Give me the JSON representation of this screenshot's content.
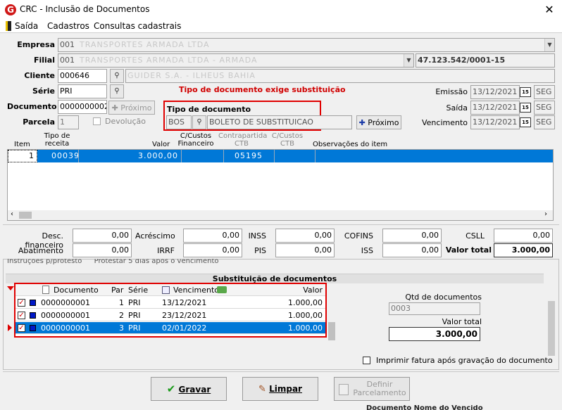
{
  "window": {
    "title": "CRC - Inclusão de Documentos",
    "close": "✕"
  },
  "menu": [
    "Saída",
    "Cadastros",
    "Consultas cadastrais"
  ],
  "labels": {
    "empresa": "Empresa",
    "filial": "Filial",
    "cliente": "Cliente",
    "serie": "Série",
    "documento": "Documento",
    "parcela": "Parcela",
    "devolucao": "Devolução",
    "tipo_doc": "Tipo de documento",
    "emissao": "Emissão",
    "saida": "Saída",
    "vencimento": "Vencimento",
    "proximo": "Próximo",
    "tipo_exige": "Tipo de documento exige substituição"
  },
  "values": {
    "empresa_code": "001",
    "empresa_name": "TRANSPORTES ARMADA LTDA",
    "filial_code": "001",
    "filial_name": "TRANSPORTES ARMADA LTDA - ARMADA",
    "cnpj": "47.123.542/0001-15",
    "cliente_code": "000646",
    "cliente_name": "GUIDER S.A. - ILHEUS BAHIA",
    "serie": "PRI",
    "documento": "0000000002",
    "parcela": "1",
    "tipo_code": "BOS",
    "tipo_name": "BOLETO DE SUBSTITUICAO",
    "emissao": "13/12/2021",
    "saida": "13/12/2021",
    "vencimento": "13/12/2021",
    "weekday": "SEG",
    "cal": "15"
  },
  "grid": {
    "headers": {
      "item": "Item",
      "tipo": "Tipo de\nreceita",
      "valor": "Valor",
      "ccf": "C/Custos\nFinanceiro",
      "cp": "Contrapartida\nCTB",
      "cc": "C/Custos\nCTB",
      "obs": "Observações do item"
    },
    "row": {
      "item": "1",
      "tipo": "00039",
      "valor": "3.000,00",
      "cp": "05195"
    }
  },
  "totals": {
    "desc_fin": "Desc. financeiro",
    "acrescimo": "Acréscimo",
    "inss": "INSS",
    "cofins": "COFINS",
    "csll": "CSLL",
    "abatimento": "Abatimento",
    "irrf": "IRRF",
    "pis": "PIS",
    "iss": "ISS",
    "valor_total": "Valor total",
    "zero": "0,00",
    "total": "3.000,00"
  },
  "instr": "Instruções p/protesto",
  "instr_val": "Protestar 5 dias após o vencimento",
  "subst": {
    "title": "Substituição de documentos",
    "headers": {
      "doc": "Documento",
      "par": "Par",
      "serie": "Série",
      "venc": "Vencimento",
      "valor": "Valor"
    },
    "rows": [
      {
        "doc": "0000000001",
        "par": "1",
        "serie": "PRI",
        "venc": "13/12/2021",
        "valor": "1.000,00"
      },
      {
        "doc": "0000000001",
        "par": "2",
        "serie": "PRI",
        "venc": "23/12/2021",
        "valor": "1.000,00"
      },
      {
        "doc": "0000000001",
        "par": "3",
        "serie": "PRI",
        "venc": "02/01/2022",
        "valor": "1.000,00"
      }
    ],
    "qtd_label": "Qtd de documentos",
    "qtd": "0003",
    "vt_label": "Valor total",
    "vt": "3.000,00",
    "imprimir": "Imprimir fatura após gravação do documento"
  },
  "buttons": {
    "gravar": "Gravar",
    "limpar": "Limpar",
    "definir1": "Definir",
    "definir2": "Parcelamento"
  },
  "footer_text": "Documento  Nome do Vencido"
}
